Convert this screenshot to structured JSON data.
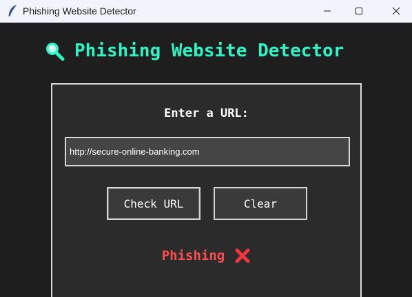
{
  "window": {
    "title": "Phishing Website Detector",
    "minimize_icon": "minimize-icon",
    "maximize_icon": "maximize-icon",
    "close_icon": "close-icon",
    "app_icon": "feather-icon"
  },
  "header": {
    "icon": "magnifier-icon",
    "title": "Phishing Website Detector"
  },
  "form": {
    "prompt": "Enter a URL:",
    "url_value": "http://secure-online-banking.com",
    "check_label": "Check URL",
    "clear_label": "Clear"
  },
  "result": {
    "label": "Phishing",
    "icon": "cross-mark-icon",
    "color": "#ff4d4d"
  },
  "colors": {
    "accent": "#2ff5c4",
    "background": "#1e1e1e",
    "panel": "#2b2b2b"
  }
}
